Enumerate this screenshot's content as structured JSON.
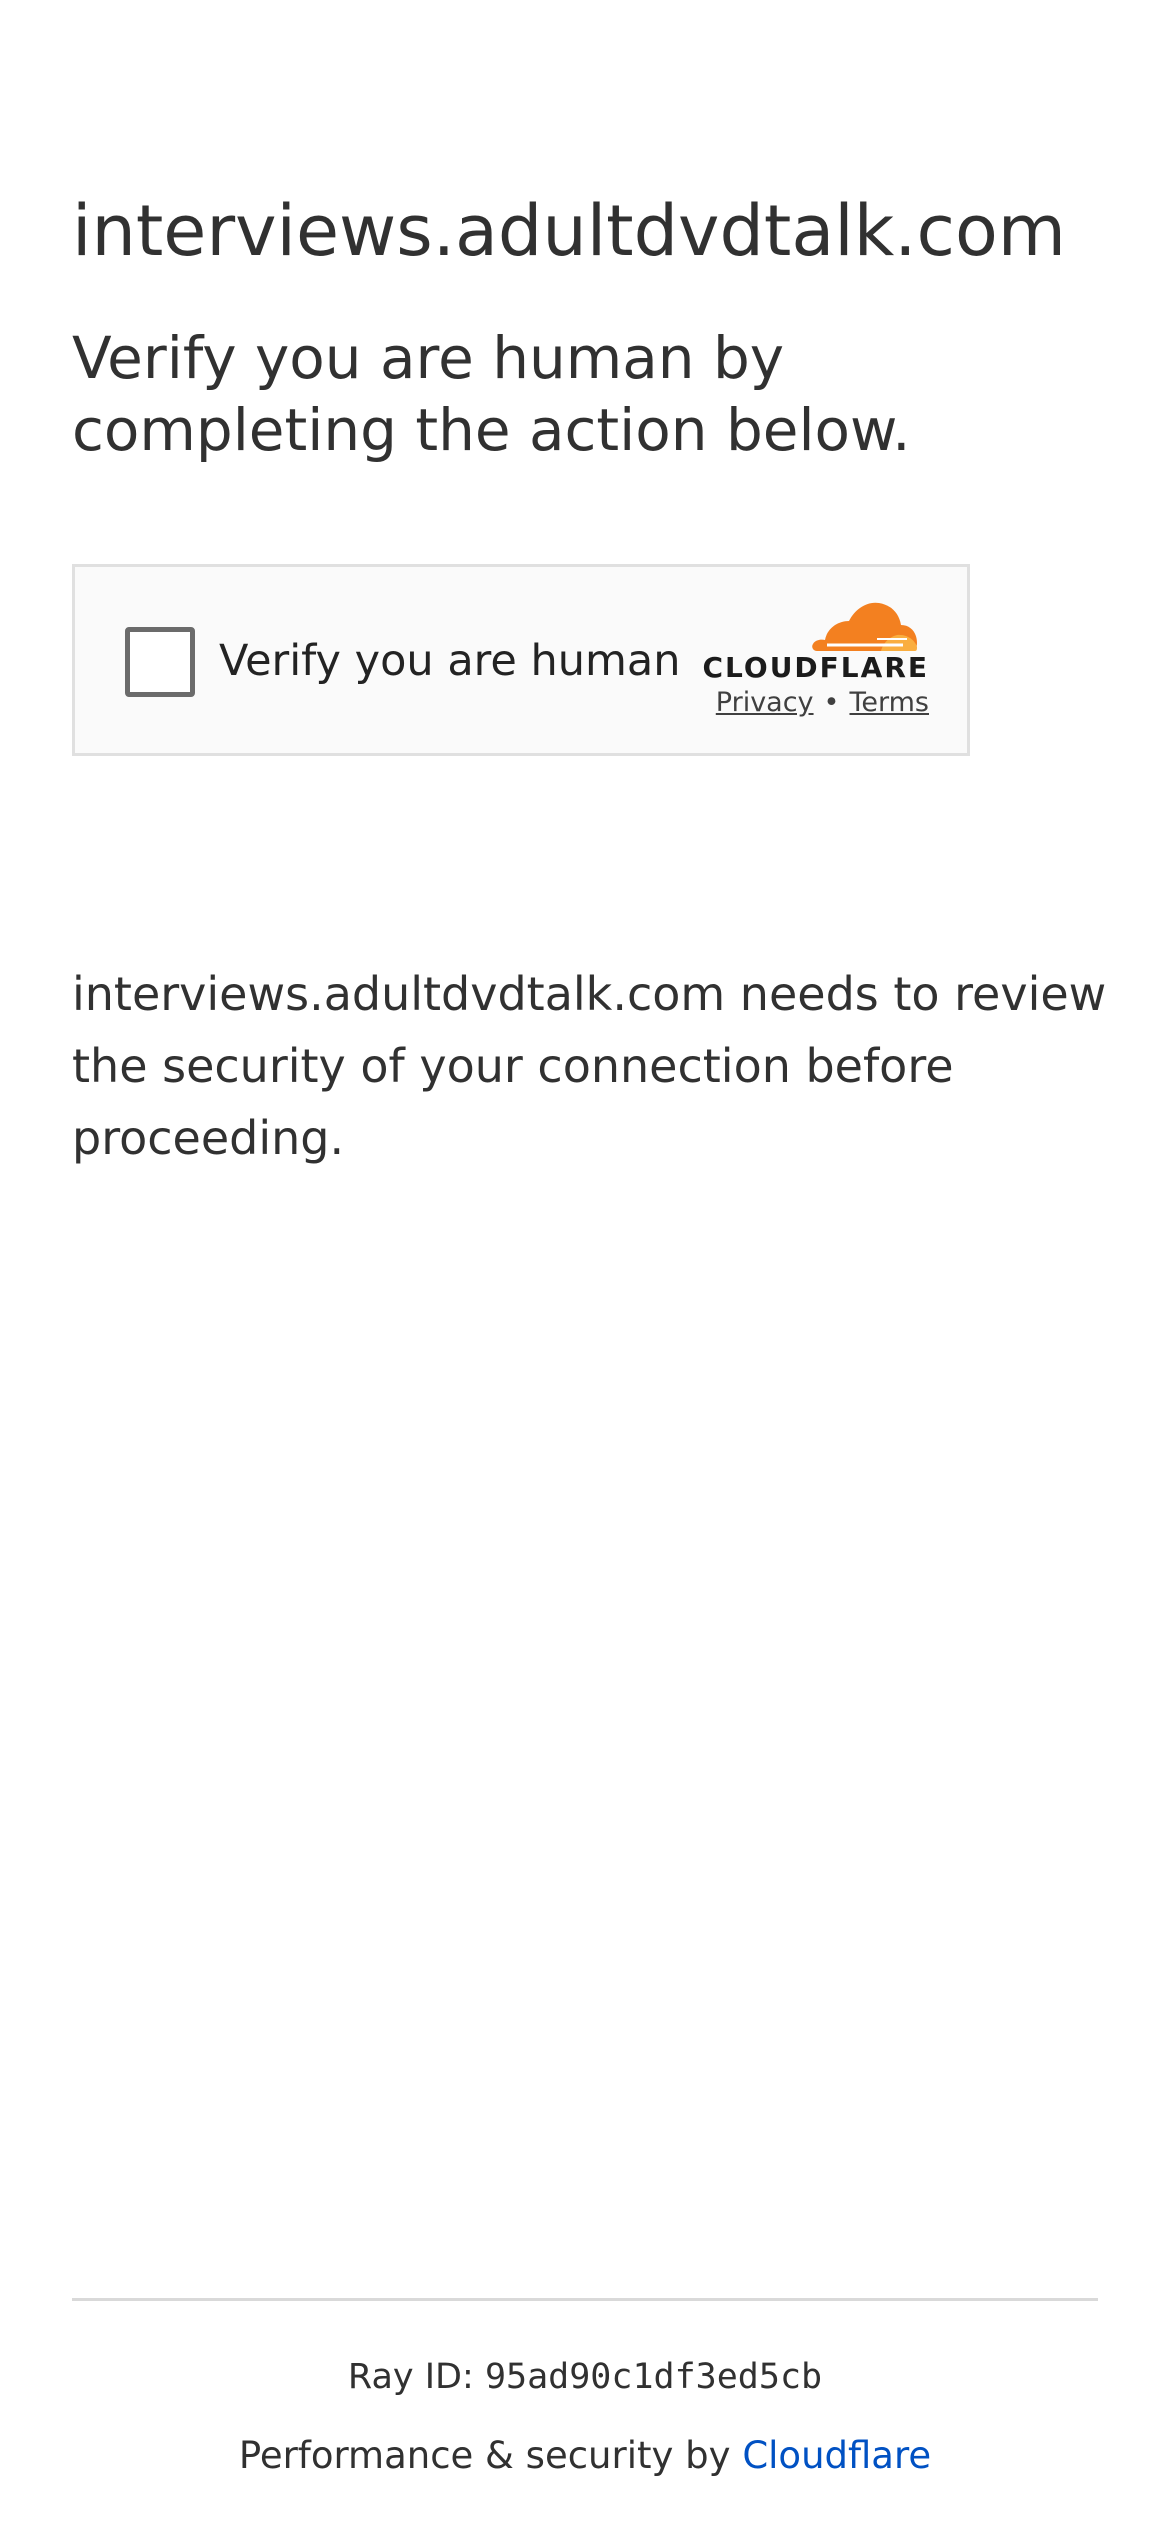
{
  "page": {
    "site_name": "interviews.adultdvdtalk.com",
    "heading": "Verify you are human by completing the action below.",
    "description": "interviews.adultdvdtalk.com needs to review the security of your connection before proceeding."
  },
  "challenge_widget": {
    "checkbox_label": "Verify you are human",
    "brand": "CLOUDFLARE",
    "privacy_link": "Privacy",
    "separator": "•",
    "terms_link": "Terms",
    "logo_icon": "cloudflare-cloud-icon",
    "logo_colors": [
      "#f38020",
      "#faae40"
    ],
    "checked": false
  },
  "footer": {
    "ray_label": "Ray ID:",
    "ray_id": "95ad90c1df3ed5cb",
    "performance_text": "Performance & security by",
    "cloudflare_link": "Cloudflare",
    "link_color": "#0051c3"
  }
}
